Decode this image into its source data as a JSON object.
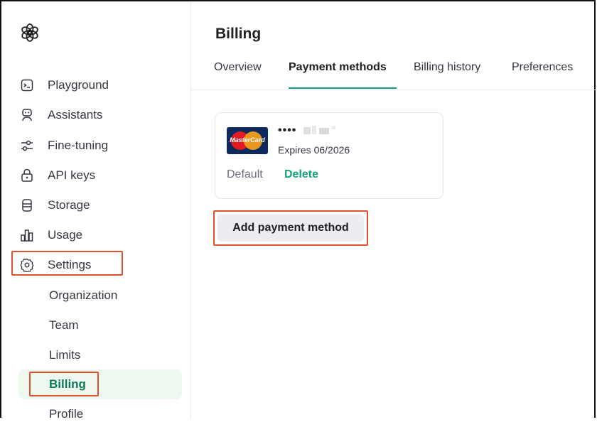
{
  "sidebar": {
    "items": [
      {
        "label": "Playground",
        "icon": "terminal-icon"
      },
      {
        "label": "Assistants",
        "icon": "robot-icon"
      },
      {
        "label": "Fine-tuning",
        "icon": "sliders-icon"
      },
      {
        "label": "API keys",
        "icon": "lock-icon"
      },
      {
        "label": "Storage",
        "icon": "database-icon"
      },
      {
        "label": "Usage",
        "icon": "bar-chart-icon"
      },
      {
        "label": "Settings",
        "icon": "gear-icon"
      }
    ],
    "settings_sub": [
      {
        "label": "Organization"
      },
      {
        "label": "Team"
      },
      {
        "label": "Limits"
      },
      {
        "label": "Billing",
        "active": true
      },
      {
        "label": "Profile"
      }
    ]
  },
  "header": {
    "title": "Billing"
  },
  "tabs": [
    {
      "label": "Overview"
    },
    {
      "label": "Payment methods",
      "active": true
    },
    {
      "label": "Billing history"
    },
    {
      "label": "Preferences"
    }
  ],
  "card": {
    "brand_text": "MasterCard",
    "masked_number": "••••",
    "expires": "Expires 06/2026",
    "default_label": "Default",
    "delete_label": "Delete"
  },
  "actions": {
    "add_payment_label": "Add payment method"
  },
  "colors": {
    "accent": "#10a37f",
    "highlight": "#e2502c",
    "active_bg": "#eef8ee"
  }
}
